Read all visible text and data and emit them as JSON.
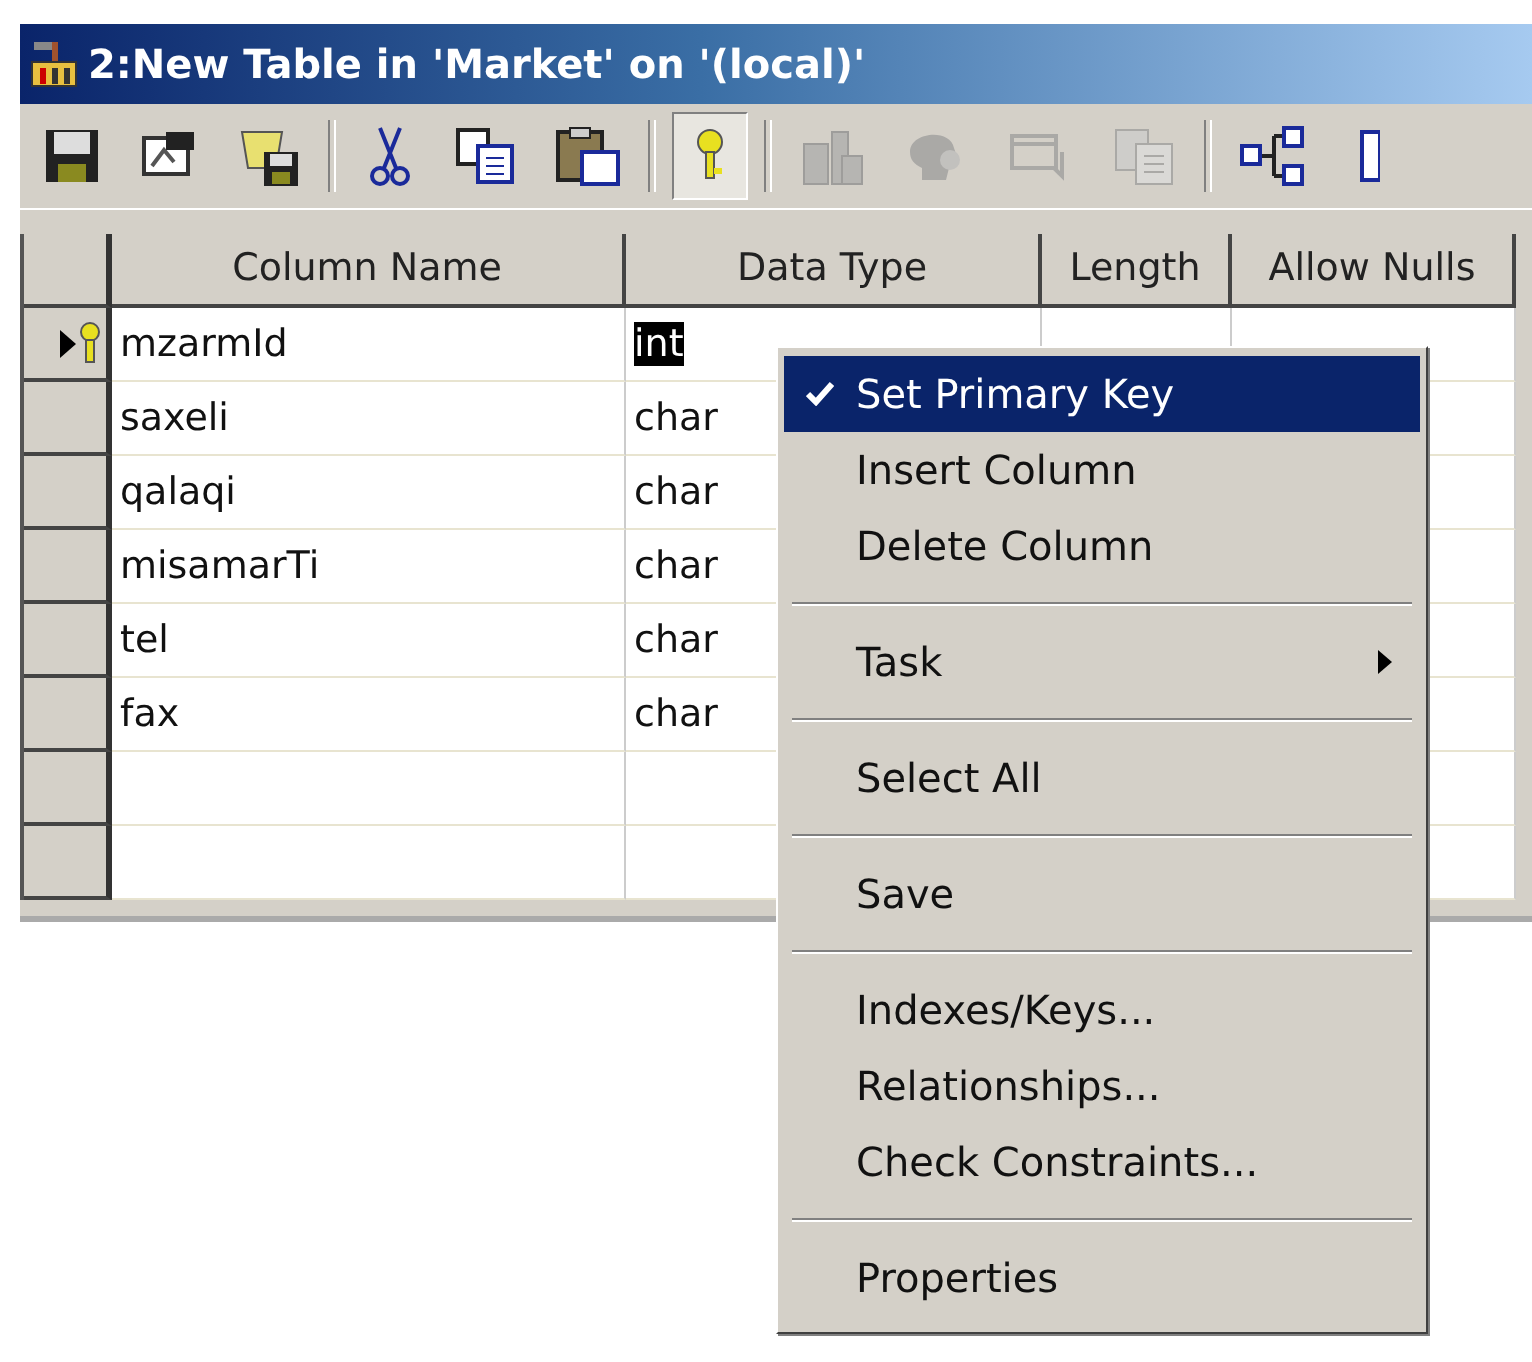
{
  "window": {
    "title": "2:New Table in 'Market' on '(local)'"
  },
  "toolbar": [
    {
      "kind": "save",
      "pressed": false,
      "disabled": false
    },
    {
      "kind": "properties",
      "pressed": false,
      "disabled": false
    },
    {
      "kind": "table-save",
      "pressed": false,
      "disabled": false
    },
    {
      "kind": "separator"
    },
    {
      "kind": "cut",
      "pressed": false,
      "disabled": false
    },
    {
      "kind": "copy",
      "pressed": false,
      "disabled": false
    },
    {
      "kind": "paste",
      "pressed": false,
      "disabled": false
    },
    {
      "kind": "separator"
    },
    {
      "kind": "key",
      "pressed": true,
      "disabled": false
    },
    {
      "kind": "separator"
    },
    {
      "kind": "building",
      "pressed": false,
      "disabled": true
    },
    {
      "kind": "head",
      "pressed": false,
      "disabled": true
    },
    {
      "kind": "window",
      "pressed": false,
      "disabled": true
    },
    {
      "kind": "docs",
      "pressed": false,
      "disabled": true
    },
    {
      "kind": "separator"
    },
    {
      "kind": "tree",
      "pressed": false,
      "disabled": false
    },
    {
      "kind": "partial",
      "pressed": false,
      "disabled": false
    }
  ],
  "table": {
    "columns": [
      "Column Name",
      "Data Type",
      "Length",
      "Allow Nulls"
    ],
    "rows": [
      {
        "name": "mzarmId",
        "type": "int",
        "current": true,
        "primary_key": true,
        "type_selected": true
      },
      {
        "name": "saxeli",
        "type": "char",
        "current": false,
        "primary_key": false,
        "type_selected": false
      },
      {
        "name": "qalaqi",
        "type": "char",
        "current": false,
        "primary_key": false,
        "type_selected": false
      },
      {
        "name": "misamarTi",
        "type": "char",
        "current": false,
        "primary_key": false,
        "type_selected": false
      },
      {
        "name": "tel",
        "type": "char",
        "current": false,
        "primary_key": false,
        "type_selected": false
      },
      {
        "name": "fax",
        "type": "char",
        "current": false,
        "primary_key": false,
        "type_selected": false
      },
      {
        "current": false,
        "primary_key": false
      },
      {
        "current": false,
        "primary_key": false
      }
    ]
  },
  "context_menu": [
    {
      "kind": "item",
      "label": "Set Primary Key",
      "checked": true,
      "selected": true,
      "submenu": false
    },
    {
      "kind": "item",
      "label": "Insert Column",
      "checked": false,
      "selected": false,
      "submenu": false
    },
    {
      "kind": "item",
      "label": "Delete Column",
      "checked": false,
      "selected": false,
      "submenu": false
    },
    {
      "kind": "separator"
    },
    {
      "kind": "item",
      "label": "Task",
      "checked": false,
      "selected": false,
      "submenu": true
    },
    {
      "kind": "separator"
    },
    {
      "kind": "item",
      "label": "Select All",
      "checked": false,
      "selected": false,
      "submenu": false
    },
    {
      "kind": "separator"
    },
    {
      "kind": "item",
      "label": "Save",
      "checked": false,
      "selected": false,
      "submenu": false
    },
    {
      "kind": "separator"
    },
    {
      "kind": "item",
      "label": "Indexes/Keys...",
      "checked": false,
      "selected": false,
      "submenu": false
    },
    {
      "kind": "item",
      "label": "Relationships...",
      "checked": false,
      "selected": false,
      "submenu": false
    },
    {
      "kind": "item",
      "label": "Check Constraints...",
      "checked": false,
      "selected": false,
      "submenu": false
    },
    {
      "kind": "separator"
    },
    {
      "kind": "item",
      "label": "Properties",
      "checked": false,
      "selected": false,
      "submenu": false
    }
  ]
}
